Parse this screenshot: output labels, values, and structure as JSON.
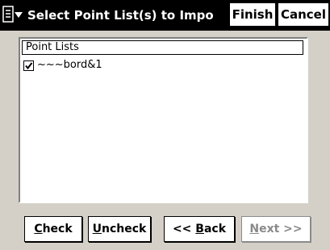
{
  "titlebar": {
    "menu_icon": "menu-dropdown-icon",
    "title": "Select Point List(s) to Impo",
    "finish_label": "Finish",
    "cancel_label": "Cancel"
  },
  "list": {
    "header": "Point Lists",
    "items": [
      {
        "label": "~~~bord&1",
        "checked": true
      }
    ]
  },
  "buttons": {
    "check": {
      "mnemonic": "C",
      "rest": "heck"
    },
    "uncheck": {
      "mnemonic": "U",
      "rest": "ncheck"
    },
    "back": {
      "prefix": "<< ",
      "mnemonic": "B",
      "rest": "ack"
    },
    "next": {
      "mnemonic": "N",
      "rest": "ext >>",
      "enabled": false
    }
  },
  "colors": {
    "background": "#d4d0c8",
    "titlebar": "#000000",
    "disabled_text": "#8a8a8a"
  }
}
